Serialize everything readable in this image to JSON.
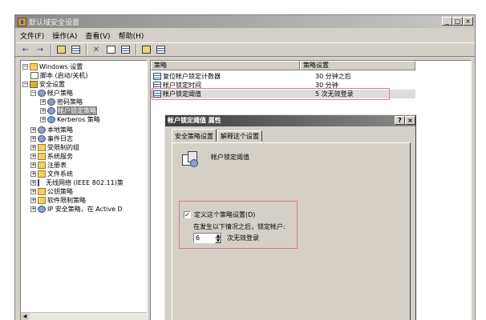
{
  "window": {
    "title": "默认域安全设置",
    "controls": {
      "minimize": "_",
      "maximize": "□",
      "close": "×"
    }
  },
  "menu": [
    "文件(F)",
    "操作(A)",
    "查看(V)",
    "帮助(H)"
  ],
  "toolbar": {
    "back": "←",
    "forward": "→"
  },
  "tree": [
    {
      "label": "Windows 设置",
      "icon": "folder-icon"
    },
    {
      "label": "脚本 (启动/关机)",
      "icon": "script-icon"
    },
    {
      "label": "安全设置",
      "icon": "security-icon"
    },
    {
      "label": "帐户策略",
      "icon": "policy-icon"
    },
    {
      "label": "密码策略",
      "icon": "policy-icon"
    },
    {
      "label": "帐户锁定策略",
      "icon": "policy-icon"
    },
    {
      "label": "Kerberos 策略",
      "icon": "policy-icon"
    },
    {
      "label": "本地策略",
      "icon": "policy-icon"
    },
    {
      "label": "事件日志",
      "icon": "policy-icon"
    },
    {
      "label": "受限制的组",
      "icon": "folder-icon"
    },
    {
      "label": "系统服务",
      "icon": "folder-icon"
    },
    {
      "label": "注册表",
      "icon": "folder-icon"
    },
    {
      "label": "文件系统",
      "icon": "folder-icon"
    },
    {
      "label": "无线网络 (IEEE 802.11)策",
      "icon": "antenna-icon"
    },
    {
      "label": "公钥策略",
      "icon": "folder-icon"
    },
    {
      "label": "软件限制策略",
      "icon": "folder-icon"
    },
    {
      "label": "IP 安全策略，在 Active D",
      "icon": "policy-icon"
    }
  ],
  "list": {
    "columns": [
      "策略",
      "策略设置"
    ],
    "rows": [
      {
        "policy": "复位帐户锁定计数器",
        "setting": "30 分钟之后"
      },
      {
        "policy": "帐户锁定时间",
        "setting": "30 分钟"
      },
      {
        "policy": "帐户锁定阈值",
        "setting": "5 次无效登录"
      }
    ]
  },
  "dialog": {
    "title": "帐户锁定阈值 属性",
    "help": "?",
    "close": "×",
    "tabs": [
      "安全策略设置",
      "解释这个设置"
    ],
    "policy_name": "帐户锁定阈值",
    "define_checkbox_label": "定义这个策略设置(D)",
    "define_checked": true,
    "check_mark": "✓",
    "description": "在发生以下情况之后，锁定帐户:",
    "threshold_value": "6",
    "spin_up": "▲",
    "spin_down": "▼",
    "unit_label": "次无效登录"
  },
  "colors": {
    "highlight_box": "#e07a8a",
    "title_gradient_start": "#3c3c3c"
  }
}
